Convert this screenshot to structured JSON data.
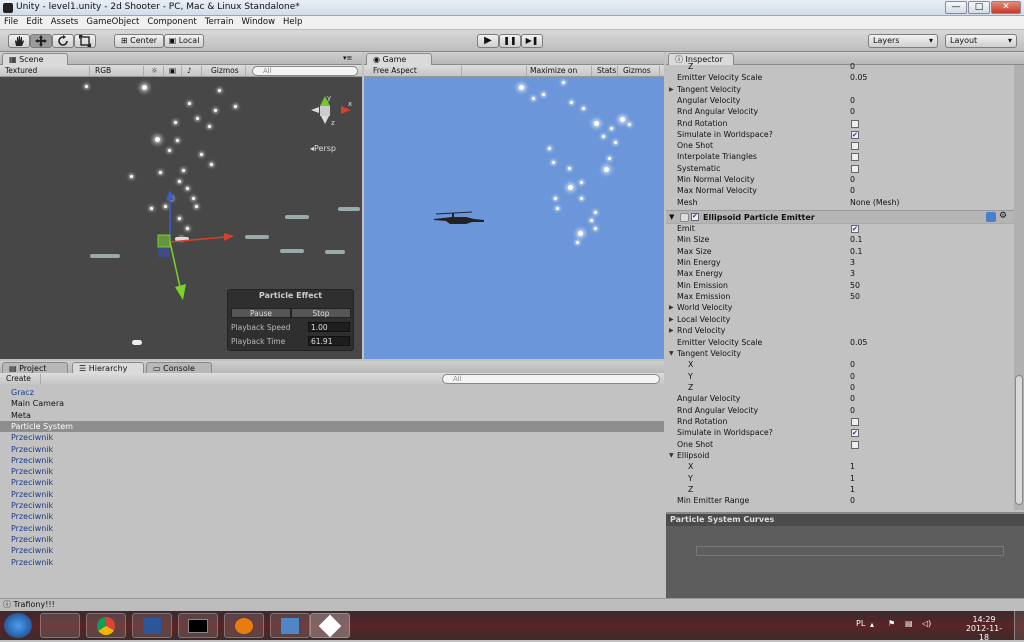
{
  "window": {
    "title": "Unity - level1.unity - 2d Shooter - PC, Mac & Linux Standalone*",
    "minimize": "—",
    "maximize": "□",
    "close": "✕"
  },
  "menu": [
    "File",
    "Edit",
    "Assets",
    "GameObject",
    "Component",
    "Terrain",
    "Window",
    "Help"
  ],
  "toolbar": {
    "tools": [
      "hand-icon",
      "move-icon",
      "rotate-icon",
      "scale-icon"
    ],
    "pivot": "Center",
    "space": "Local",
    "play": "▶",
    "pause": "❚❚",
    "step": "▶❚",
    "layers": "Layers",
    "layout": "Layout",
    "dropdown_arrow": "▾"
  },
  "scene": {
    "tab": "Scene",
    "shading": "Textured",
    "mode": "RGB",
    "gizmos": "Gizmos",
    "search_placeholder": "All",
    "persp": "Persp",
    "gizmo_axes": {
      "y": "y",
      "x": "x",
      "z": "z"
    }
  },
  "particle_effect": {
    "title": "Particle Effect",
    "pause": "Pause",
    "stop": "Stop",
    "speed_label": "Playback Speed",
    "speed_value": "1.00",
    "time_label": "Playback Time",
    "time_value": "61.91"
  },
  "game": {
    "tab": "Game",
    "aspect": "Free Aspect",
    "maximize": "Maximize on Play",
    "stats": "Stats",
    "gizmos": "Gizmos"
  },
  "inspector": {
    "tab": "Inspector",
    "top_rows": [
      {
        "label": "Z",
        "indent": 2,
        "value": "0",
        "type": "text"
      },
      {
        "label": "Emitter Velocity Scale",
        "indent": 1,
        "value": "0.05",
        "type": "text"
      },
      {
        "label": "Tangent Velocity",
        "indent": 1,
        "value": "",
        "type": "fold"
      },
      {
        "label": "Angular Velocity",
        "indent": 1,
        "value": "0",
        "type": "text"
      },
      {
        "label": "Rnd Angular Velocity",
        "indent": 1,
        "value": "0",
        "type": "text"
      },
      {
        "label": "Rnd Rotation",
        "indent": 1,
        "value": "",
        "type": "check",
        "checked": false
      },
      {
        "label": "Simulate in Worldspace?",
        "indent": 1,
        "value": "",
        "type": "check",
        "checked": true
      },
      {
        "label": "One Shot",
        "indent": 1,
        "value": "",
        "type": "check",
        "checked": false
      },
      {
        "label": "Interpolate Triangles",
        "indent": 1,
        "value": "",
        "type": "check",
        "checked": false
      },
      {
        "label": "Systematic",
        "indent": 1,
        "value": "",
        "type": "check",
        "checked": false
      },
      {
        "label": "Min Normal Velocity",
        "indent": 1,
        "value": "0",
        "type": "text"
      },
      {
        "label": "Max Normal Velocity",
        "indent": 1,
        "value": "0",
        "type": "text"
      },
      {
        "label": "Mesh",
        "indent": 1,
        "value": "None (Mesh)",
        "type": "text"
      }
    ],
    "component_title": "Ellipsoid Particle Emitter",
    "rows": [
      {
        "label": "Emit",
        "indent": 1,
        "value": "",
        "type": "check",
        "checked": true
      },
      {
        "label": "Min Size",
        "indent": 1,
        "value": "0.1",
        "type": "text"
      },
      {
        "label": "Max Size",
        "indent": 1,
        "value": "0.1",
        "type": "text"
      },
      {
        "label": "Min Energy",
        "indent": 1,
        "value": "3",
        "type": "text"
      },
      {
        "label": "Max Energy",
        "indent": 1,
        "value": "3",
        "type": "text"
      },
      {
        "label": "Min Emission",
        "indent": 1,
        "value": "50",
        "type": "text"
      },
      {
        "label": "Max Emission",
        "indent": 1,
        "value": "50",
        "type": "text"
      },
      {
        "label": "World Velocity",
        "indent": 1,
        "value": "",
        "type": "fold"
      },
      {
        "label": "Local Velocity",
        "indent": 1,
        "value": "",
        "type": "fold"
      },
      {
        "label": "Rnd Velocity",
        "indent": 1,
        "value": "",
        "type": "fold"
      },
      {
        "label": "Emitter Velocity Scale",
        "indent": 1,
        "value": "0.05",
        "type": "text"
      },
      {
        "label": "Tangent Velocity",
        "indent": 1,
        "value": "",
        "type": "foldopen"
      },
      {
        "label": "X",
        "indent": 2,
        "value": "0",
        "type": "text"
      },
      {
        "label": "Y",
        "indent": 2,
        "value": "0",
        "type": "text"
      },
      {
        "label": "Z",
        "indent": 2,
        "value": "0",
        "type": "text"
      },
      {
        "label": "Angular Velocity",
        "indent": 1,
        "value": "0",
        "type": "text"
      },
      {
        "label": "Rnd Angular Velocity",
        "indent": 1,
        "value": "0",
        "type": "text"
      },
      {
        "label": "Rnd Rotation",
        "indent": 1,
        "value": "",
        "type": "check",
        "checked": false
      },
      {
        "label": "Simulate in Worldspace?",
        "indent": 1,
        "value": "",
        "type": "check",
        "checked": true
      },
      {
        "label": "One Shot",
        "indent": 1,
        "value": "",
        "type": "check",
        "checked": false
      },
      {
        "label": "Ellipsoid",
        "indent": 1,
        "value": "",
        "type": "foldopen"
      },
      {
        "label": "X",
        "indent": 2,
        "value": "1",
        "type": "text"
      },
      {
        "label": "Y",
        "indent": 2,
        "value": "1",
        "type": "text"
      },
      {
        "label": "Z",
        "indent": 2,
        "value": "1",
        "type": "text"
      },
      {
        "label": "Min Emitter Range",
        "indent": 1,
        "value": "0",
        "type": "text"
      }
    ],
    "curves_title": "Particle System Curves"
  },
  "bottom_tabs": {
    "project": "Project",
    "hierarchy": "Hierarchy",
    "console": "Console",
    "create": "Create",
    "search_placeholder": "All"
  },
  "hierarchy": [
    {
      "name": "Gracz",
      "style": "prefab"
    },
    {
      "name": "Main Camera",
      "style": "normal"
    },
    {
      "name": "Meta",
      "style": "normal"
    },
    {
      "name": "Particle System",
      "style": "selected"
    },
    {
      "name": "Przeciwnik",
      "style": "prefab"
    },
    {
      "name": "Przeciwnik",
      "style": "prefab"
    },
    {
      "name": "Przeciwnik",
      "style": "prefab"
    },
    {
      "name": "Przeciwnik",
      "style": "prefab"
    },
    {
      "name": "Przeciwnik",
      "style": "prefab"
    },
    {
      "name": "Przeciwnik",
      "style": "prefab"
    },
    {
      "name": "Przeciwnik",
      "style": "prefab"
    },
    {
      "name": "Przeciwnik",
      "style": "prefab"
    },
    {
      "name": "Przeciwnik",
      "style": "prefab"
    },
    {
      "name": "Przeciwnik",
      "style": "prefab"
    },
    {
      "name": "Przeciwnik",
      "style": "prefab"
    },
    {
      "name": "Przeciwnik",
      "style": "prefab"
    }
  ],
  "status": "Trafiony!!!",
  "taskbar": {
    "lang": "PL",
    "time": "14:29",
    "date": "2012-11-18"
  },
  "colors": {
    "game_bg": "#6b96da",
    "scene_bg": "#474747",
    "selection": "#8e8e8e",
    "prefab_text": "#1e3c8c"
  }
}
